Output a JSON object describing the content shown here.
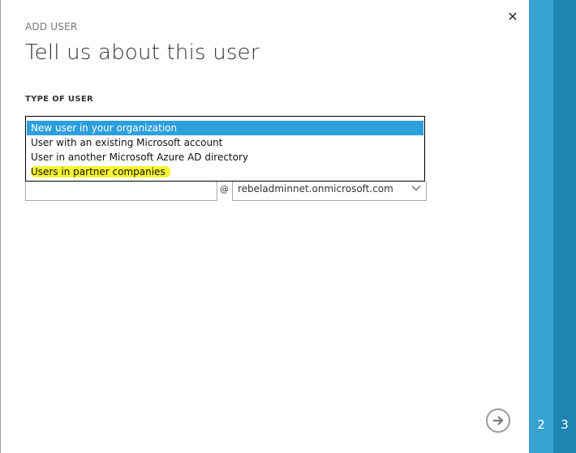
{
  "dialog": {
    "step_label": "ADD USER",
    "title": "Tell us about this user",
    "close_glyph": "✕"
  },
  "type_of_user": {
    "label": "TYPE OF USER",
    "options": [
      {
        "label": "New user in your organization",
        "selected": true
      },
      {
        "label": "User with an existing Microsoft account",
        "selected": false
      },
      {
        "label": "User in another Microsoft Azure AD directory",
        "selected": false
      },
      {
        "label": "Users in partner companies",
        "selected": false,
        "highlighted": true
      }
    ]
  },
  "user_name": {
    "value": "",
    "at_sign": "@",
    "domain": "rebeladminnet.onmicrosoft.com"
  },
  "wizard": {
    "steps": [
      "2",
      "3"
    ]
  },
  "icons": {
    "close": "close-icon",
    "next": "arrow-right-icon",
    "dropdown": "chevron-down-icon"
  },
  "colors": {
    "selection": "#2d9fdc",
    "highlight": "#f7f530",
    "step2": "#36a2d2",
    "step3": "#1f85b3"
  }
}
